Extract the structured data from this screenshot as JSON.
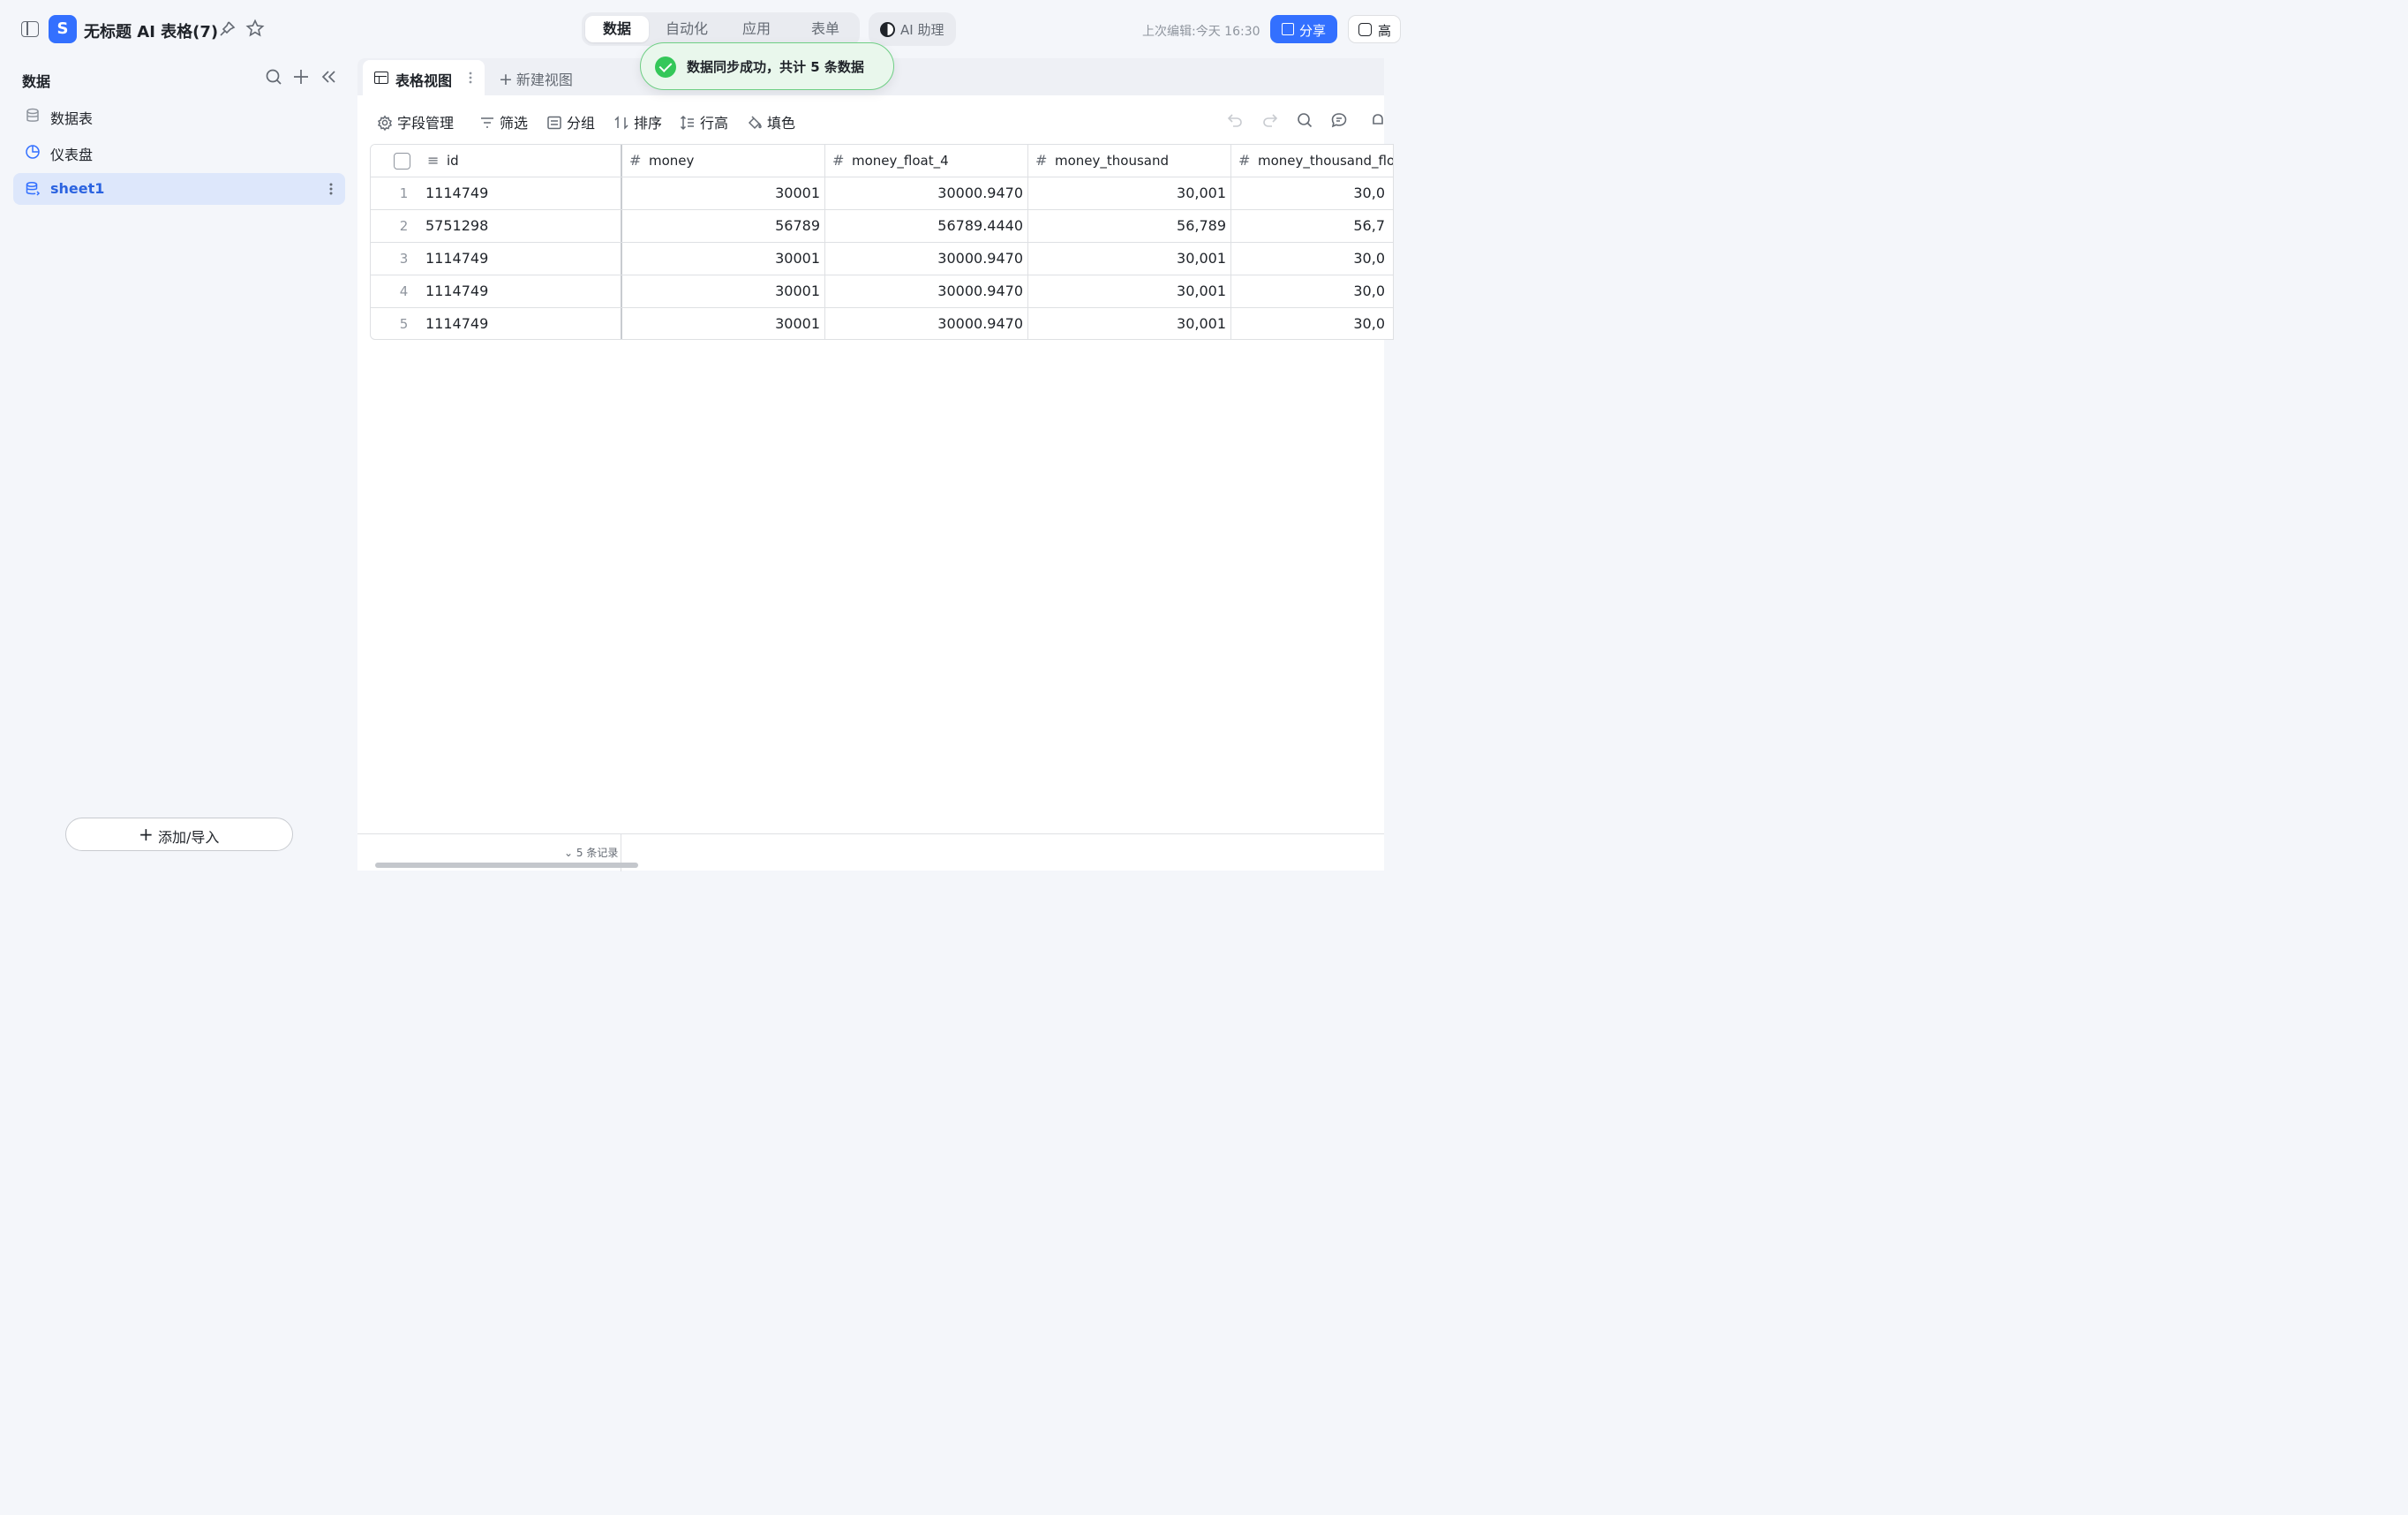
{
  "topbar": {
    "doc_title": "无标题 AI 表格(7)",
    "mode_tabs": [
      {
        "label": "数据",
        "active": true
      },
      {
        "label": "自动化",
        "active": false
      },
      {
        "label": "应用",
        "active": false
      },
      {
        "label": "表单",
        "active": false
      }
    ],
    "ai_label": "AI 助理",
    "last_edit": "上次编辑:今天 16:30",
    "share_label": "分享",
    "more_label": "高"
  },
  "toast": {
    "text": "数据同步成功，共计 5 条数据",
    "color": "#34c759"
  },
  "sidebar": {
    "title": "数据",
    "items": [
      {
        "label": "数据表",
        "icon": "database-icon",
        "active": false
      },
      {
        "label": "仪表盘",
        "icon": "dashboard-icon",
        "active": false
      },
      {
        "label": "sheet1",
        "icon": "sheet-icon",
        "active": true
      }
    ],
    "add_import_label": "添加/导入"
  },
  "view": {
    "active_tab": "表格视图",
    "new_view": "新建视图"
  },
  "toolbar": {
    "field_manage": "字段管理",
    "filter": "筛选",
    "group": "分组",
    "sort": "排序",
    "row_height": "行高",
    "fill_color": "填色"
  },
  "table": {
    "columns": [
      "id",
      "money",
      "money_float_4",
      "money_thousand",
      "money_thousand_flo"
    ],
    "rows": [
      {
        "n": "1",
        "id": "1114749",
        "money": "30001",
        "money_float_4": "30000.9470",
        "money_thousand": "30,001",
        "money_thousand_flo": "30,0"
      },
      {
        "n": "2",
        "id": "5751298",
        "money": "56789",
        "money_float_4": "56789.4440",
        "money_thousand": "56,789",
        "money_thousand_flo": "56,7"
      },
      {
        "n": "3",
        "id": "1114749",
        "money": "30001",
        "money_float_4": "30000.9470",
        "money_thousand": "30,001",
        "money_thousand_flo": "30,0"
      },
      {
        "n": "4",
        "id": "1114749",
        "money": "30001",
        "money_float_4": "30000.9470",
        "money_thousand": "30,001",
        "money_thousand_flo": "30,0"
      },
      {
        "n": "5",
        "id": "1114749",
        "money": "30001",
        "money_float_4": "30000.9470",
        "money_thousand": "30,001",
        "money_thousand_flo": "30,0"
      }
    ]
  },
  "footer": {
    "record_count": "5 条记录"
  },
  "colors": {
    "accent": "#3370ff",
    "active_bg": "#dde7fb",
    "toast_bg": "#e9f7ec"
  }
}
